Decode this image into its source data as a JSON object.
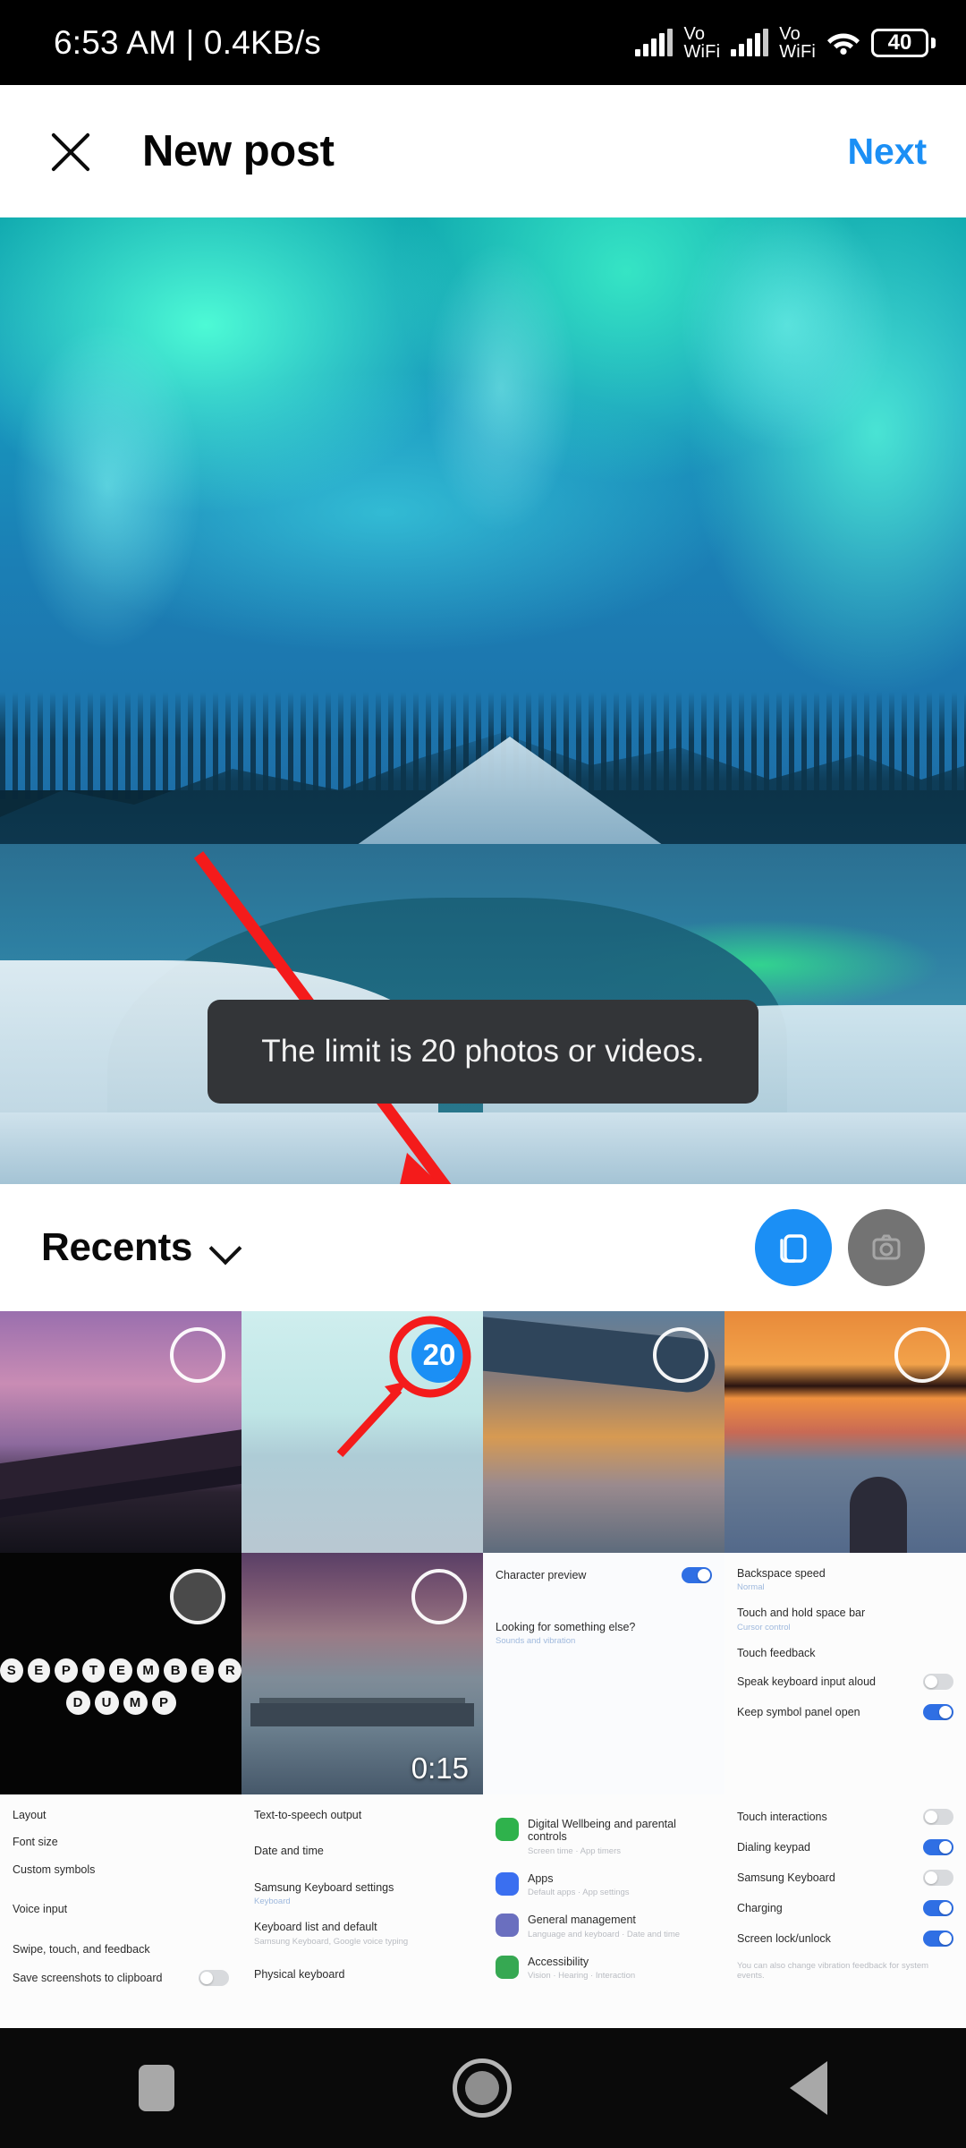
{
  "status_bar": {
    "time": "6:53 AM",
    "separator": "|",
    "network_speed": "0.4KB/s",
    "time_and_speed": "6:53 AM | 0.4KB/s",
    "sim1_label_top": "Vo",
    "sim1_label_bottom": "WiFi",
    "sim2_label_top": "Vo",
    "sim2_label_bottom": "WiFi",
    "battery_percent": "40",
    "icons": [
      "signal-bars-icon",
      "volte-wifi-icon",
      "signal-bars-icon",
      "volte-wifi-icon",
      "wifi-icon",
      "battery-icon"
    ]
  },
  "app_bar": {
    "close_icon": "close-icon",
    "title": "New post",
    "next_label": "Next",
    "next_color": "#1b8ff5"
  },
  "preview": {
    "description": "aurora-over-snowy-river-photo",
    "annotation": "red-arrow-pointing-down-right"
  },
  "toast": {
    "message": "The limit is 20 photos or videos.",
    "background": "#333538",
    "text_color": "#f2f2f2"
  },
  "gallery": {
    "album_label": "Recents",
    "album_chevron": "chevron-down-icon",
    "multi_select_icon": "multi-select-icon",
    "camera_icon": "camera-icon",
    "accent_color": "#1b8ff5",
    "items": [
      {
        "name": "bridge-at-dusk-photo",
        "selection": "empty",
        "badge": "",
        "duration": ""
      },
      {
        "name": "sea-horizon-photo",
        "selection": "count",
        "badge": "20",
        "duration": "",
        "annotated": true
      },
      {
        "name": "airplane-window-sunset-photo",
        "selection": "empty",
        "badge": "",
        "duration": ""
      },
      {
        "name": "person-at-sunset-lake-photo",
        "selection": "empty",
        "badge": "",
        "duration": ""
      },
      {
        "name": "september-dump-black-photo",
        "selection": "dark",
        "badge": "",
        "duration": "",
        "overlay_lines": [
          "SEPTEMBER",
          "DUMP"
        ]
      },
      {
        "name": "harbour-bridge-night-video",
        "selection": "empty",
        "badge": "",
        "duration": "0:15"
      },
      {
        "name": "keyboard-settings-screenshot",
        "selection": "",
        "badge": "",
        "duration": ""
      },
      {
        "name": "keyboard-toggles-screenshot",
        "selection": "",
        "badge": "",
        "duration": ""
      },
      {
        "name": "keyboard-layout-screenshot",
        "selection": "",
        "badge": "",
        "duration": ""
      },
      {
        "name": "text-to-speech-screenshot",
        "selection": "",
        "badge": "",
        "duration": ""
      },
      {
        "name": "android-settings-screenshot",
        "selection": "",
        "badge": "",
        "duration": ""
      },
      {
        "name": "touch-toggles-screenshot",
        "selection": "",
        "badge": "",
        "duration": ""
      }
    ],
    "thumb_texts": {
      "character_preview": {
        "row1": "Character preview",
        "row1_toggle": "on",
        "row2": "Looking for something else?",
        "row2_sub": "Sounds and vibration"
      },
      "backspace": {
        "row1": "Backspace speed",
        "row1_sub": "Normal",
        "row2": "Touch and hold space bar",
        "row2_sub": "Cursor control",
        "row3": "Touch feedback",
        "row4": "Speak keyboard input aloud",
        "row4_toggle": "off",
        "row5": "Keep symbol panel open",
        "row5_toggle": "on"
      },
      "layout": {
        "row1": "Layout",
        "row2": "Font size",
        "row3": "Custom symbols",
        "row4": "Voice input",
        "row5": "Swipe, touch, and feedback",
        "row6": "Save screenshots to clipboard"
      },
      "tts": {
        "row1": "Text-to-speech output",
        "row2": "Date and time",
        "row3": "Samsung Keyboard settings",
        "row3_sub": "Keyboard",
        "row4": "Keyboard list and default",
        "row4_sub": "Samsung Keyboard, Google voice typing",
        "row5": "Physical keyboard"
      },
      "settings": {
        "row1": "Digital Wellbeing and parental controls",
        "row1_sub": "Screen time · App timers",
        "row2": "Apps",
        "row2_sub": "Default apps · App settings",
        "row3": "General management",
        "row3_sub": "Language and keyboard · Date and time",
        "row4": "Accessibility",
        "row4_sub": "Vision · Hearing · Interaction"
      },
      "touch": {
        "row1": "Touch interactions",
        "row1_toggle": "off",
        "row2": "Dialing keypad",
        "row2_toggle": "on",
        "row3": "Samsung Keyboard",
        "row3_toggle": "off",
        "row4": "Charging",
        "row4_toggle": "on",
        "row5": "Screen lock/unlock",
        "row5_toggle": "on",
        "footer": "You can also change vibration feedback for system events."
      }
    }
  },
  "nav_bar": {
    "recents_icon": "recents-square-icon",
    "home_icon": "home-circle-icon",
    "back_icon": "back-triangle-icon"
  }
}
